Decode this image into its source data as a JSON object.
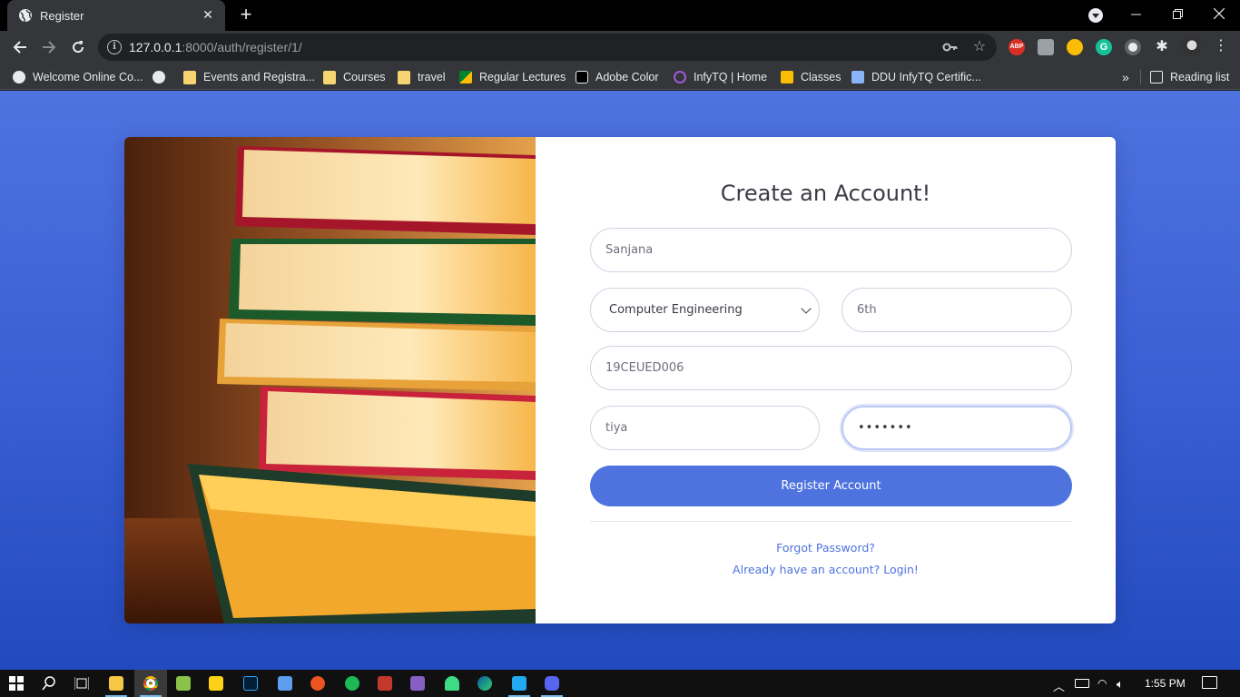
{
  "browser": {
    "tab_title": "Register",
    "url_host": "127.0.0.1",
    "url_rest": ":8000/auth/register/1/",
    "bookmarks": [
      {
        "label": "Welcome Online Co...",
        "icon": "globe-icon"
      },
      {
        "label": "",
        "icon": "globe-icon"
      },
      {
        "label": "Events and Registra...",
        "icon": "folder-icon"
      },
      {
        "label": "Courses",
        "icon": "folder-icon"
      },
      {
        "label": "travel",
        "icon": "folder-icon"
      },
      {
        "label": "Regular Lectures",
        "icon": "meet-icon"
      },
      {
        "label": "Adobe Color",
        "icon": "adobe-color-icon"
      },
      {
        "label": "InfyTQ | Home",
        "icon": "infytq-icon"
      },
      {
        "label": "Classes",
        "icon": "classroom-icon"
      },
      {
        "label": "DDU InfyTQ Certific...",
        "icon": "chat-icon"
      }
    ],
    "more_bookmarks": "»",
    "reading_list": "Reading list"
  },
  "form": {
    "title": "Create an Account!",
    "name_value": "Sanjana",
    "department_value": "Computer Engineering",
    "semester_value": "6th",
    "enrollment_value": "19CEUED006",
    "username_value": "tiya",
    "password_value": "•••••••",
    "register_label": "Register Account",
    "forgot_label": "Forgot Password?",
    "login_label": "Already have an account? Login!"
  },
  "taskbar": {
    "time": "1:55 PM"
  },
  "colors": {
    "accent": "#4e73df",
    "page_gradient_top": "#4e73df",
    "page_gradient_bottom": "#224abe"
  }
}
